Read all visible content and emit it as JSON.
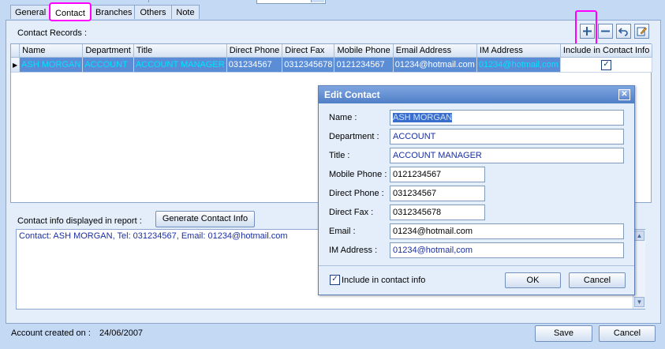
{
  "tabs": [
    {
      "label": "General"
    },
    {
      "label": "Contact"
    },
    {
      "label": "Branches"
    },
    {
      "label": "Others"
    },
    {
      "label": "Note"
    }
  ],
  "contact_records_label": "Contact  Records :",
  "toolbar": {
    "add_icon": "plus-icon",
    "remove_icon": "minus-icon",
    "undo_icon": "undo-icon",
    "edit_icon": "edit-icon"
  },
  "grid": {
    "columns": [
      "Name",
      "Department",
      "Title",
      "Direct Phone",
      "Direct Fax",
      "Mobile Phone",
      "Email Address",
      "IM Address",
      "Include in Contact Info"
    ],
    "rows": [
      {
        "name": "ASH MORGAN",
        "department": "ACCOUNT",
        "title": "ACCOUNT MANAGER",
        "direct_phone": "031234567",
        "direct_fax": "0312345678",
        "mobile_phone": "0121234567",
        "email": "01234@hotmail.com",
        "im": "01234@hotmail,com",
        "include": true
      }
    ]
  },
  "report": {
    "label": "Contact info displayed in report :",
    "generate_button": "Generate Contact Info",
    "text": "Contact: ASH MORGAN, Tel: 031234567, Email: 01234@hotmail.com"
  },
  "dialog": {
    "title": "Edit Contact",
    "fields": {
      "name": {
        "label": "Name :",
        "value": "ASH MORGAN"
      },
      "department": {
        "label": "Department :",
        "value": "ACCOUNT"
      },
      "title": {
        "label": "Title :",
        "value": "ACCOUNT MANAGER"
      },
      "mobile": {
        "label": "Mobile Phone :",
        "value": "0121234567"
      },
      "direct_phone": {
        "label": "Direct Phone :",
        "value": "031234567"
      },
      "direct_fax": {
        "label": "Direct Fax :",
        "value": "0312345678"
      },
      "email": {
        "label": "Email :",
        "value": "01234@hotmail.com"
      },
      "im": {
        "label": "IM Address :",
        "value": "01234@hotmail,com"
      }
    },
    "include_label": "Include in contact info",
    "ok_label": "OK",
    "cancel_label": "Cancel"
  },
  "footer": {
    "account_created_label": "Account created on :",
    "account_created_date": "24/06/2007",
    "save_label": "Save",
    "cancel_label": "Cancel"
  }
}
